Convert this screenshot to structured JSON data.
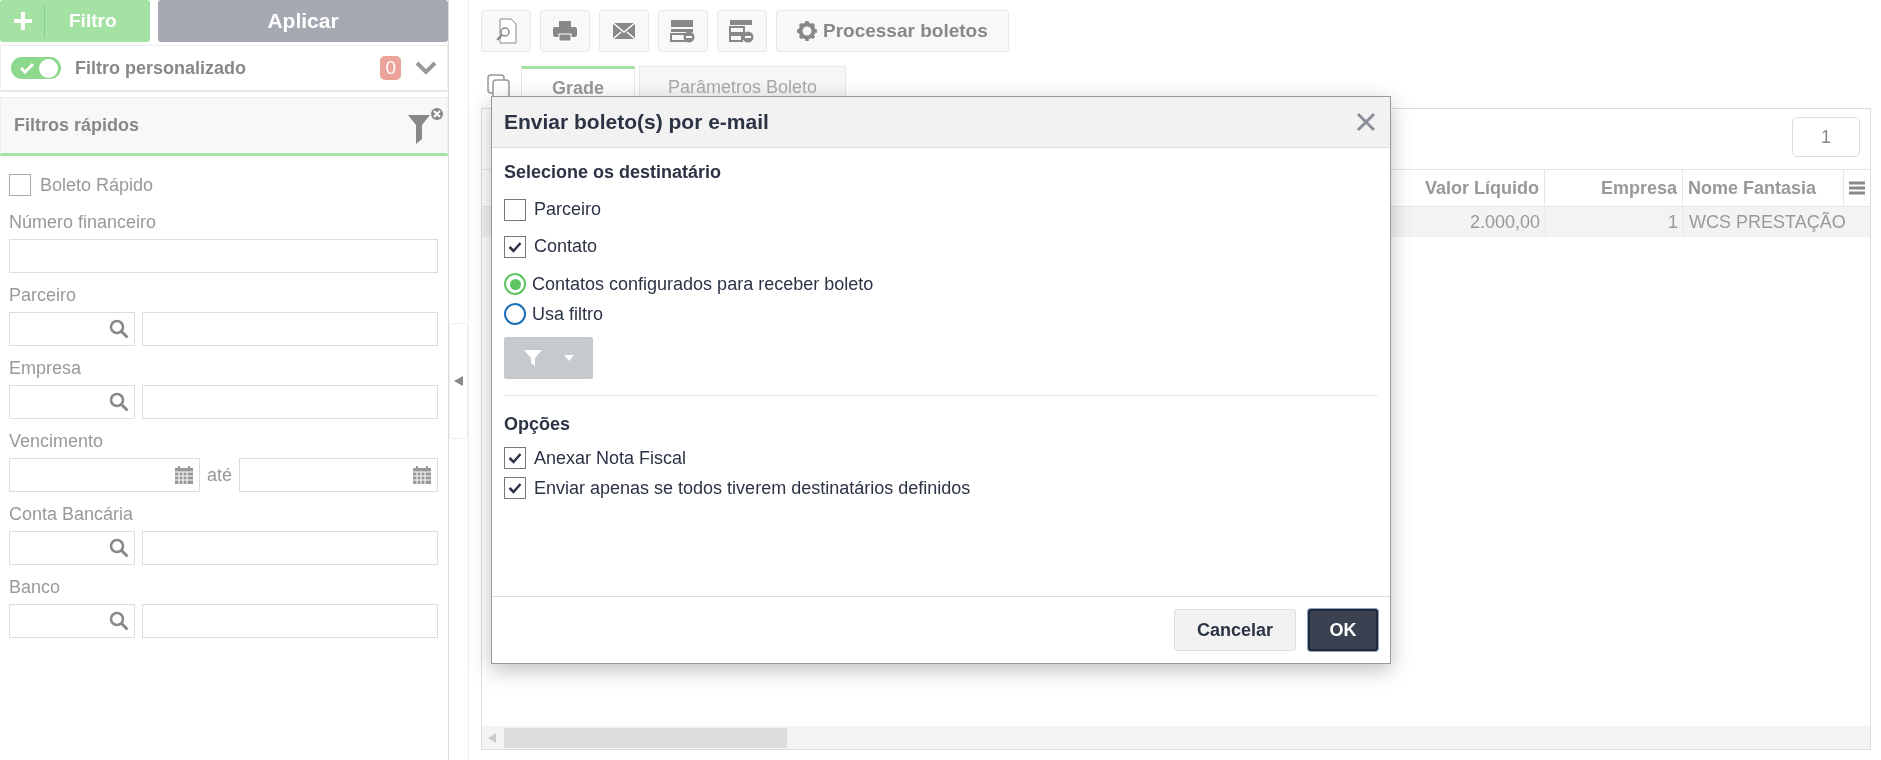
{
  "filter_panel": {
    "add_button": "Filtro",
    "apply_button": "Aplicar",
    "custom_filter": {
      "label": "Filtro personalizado",
      "on": true,
      "count": "0"
    },
    "quick_filters": {
      "title": "Filtros rápidos",
      "fields": [
        {
          "kind": "checkbox",
          "label": "Boleto Rápido",
          "checked": false
        },
        {
          "kind": "text",
          "label": "Número financeiro"
        },
        {
          "kind": "lookup",
          "label": "Parceiro"
        },
        {
          "kind": "lookup",
          "label": "Empresa"
        },
        {
          "kind": "date_range",
          "label": "Vencimento",
          "separator": "até"
        },
        {
          "kind": "lookup",
          "label": "Conta Bancária"
        },
        {
          "kind": "lookup",
          "label": "Banco"
        }
      ]
    }
  },
  "toolbar": {
    "process_button": "Processar boletos"
  },
  "tabs": [
    {
      "label": "Grade",
      "selected": true
    },
    {
      "label": "Parâmetros Boleto",
      "selected": false
    }
  ],
  "grid": {
    "columns": [
      "Valor Líquido",
      "Empresa",
      "Nome Fantasia"
    ],
    "rows": [
      [
        "2.000,00",
        "1",
        "WCS PRESTAÇÃO"
      ]
    ],
    "page_tooltip": "1"
  },
  "dialog": {
    "title": "Enviar boleto(s) por e-mail",
    "recipients_heading": "Selecione os destinatário",
    "recipients": [
      {
        "label": "Parceiro",
        "checked": false
      },
      {
        "label": "Contato",
        "checked": true
      }
    ],
    "contact_source": [
      {
        "label": "Contatos configurados para receber boleto",
        "selected": true
      },
      {
        "label": "Usa filtro",
        "selected": false
      }
    ],
    "options_heading": "Opções",
    "options": [
      {
        "label": "Anexar Nota Fiscal",
        "checked": true
      },
      {
        "label": "Enviar apenas se todos tiverem destinatários definidos",
        "checked": true
      }
    ],
    "buttons": [
      {
        "label": "Cancelar",
        "kind": "secondary"
      },
      {
        "label": "OK",
        "kind": "primary"
      }
    ]
  }
}
